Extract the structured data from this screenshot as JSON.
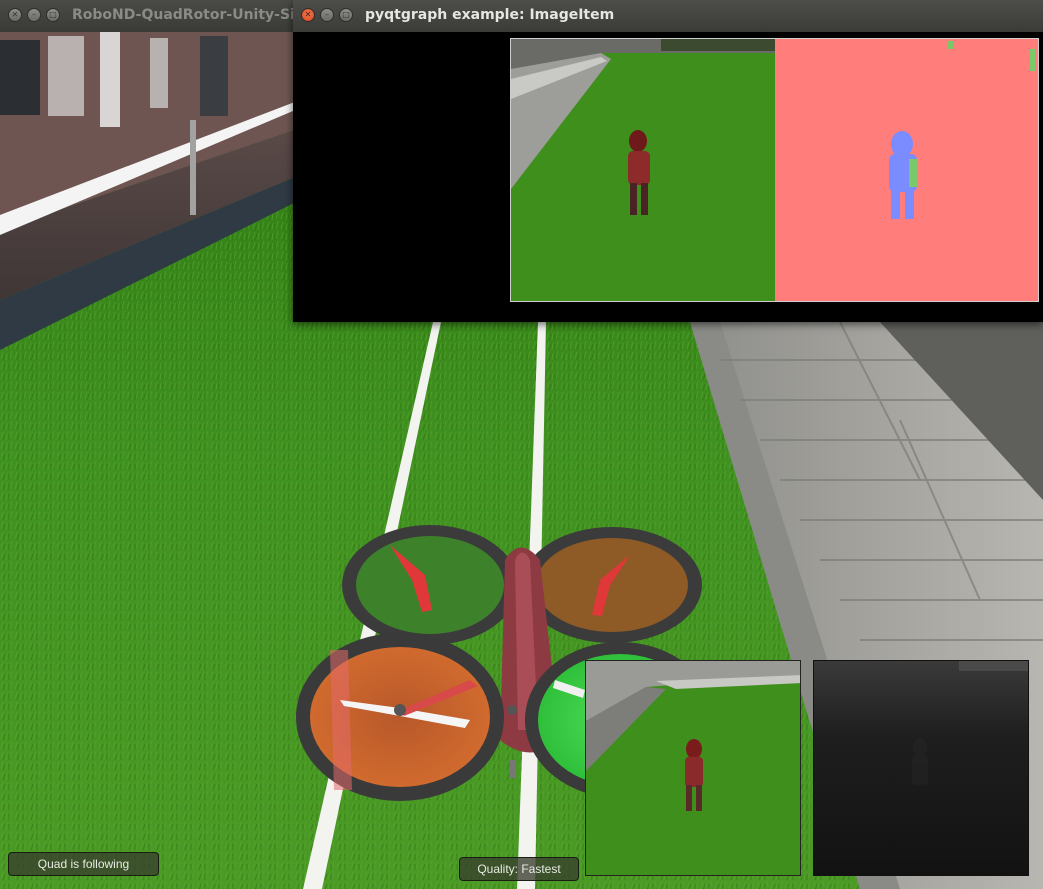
{
  "sim_window": {
    "title": "RoboND-QuadRotor-Unity-Simu",
    "buttons": [
      "close",
      "minimize",
      "maximize"
    ]
  },
  "pg_window": {
    "title": "pyqtgraph example: ImageItem",
    "buttons": [
      "close",
      "minimize",
      "maximize"
    ]
  },
  "status": {
    "follow_label": "Quad is following",
    "quality_label": "Quality: Fastest"
  },
  "icons": {
    "close": "close-icon",
    "minimize": "minimize-icon",
    "maximize": "maximize-icon"
  },
  "colors": {
    "grass": "#3f8f1d",
    "segmentation_background": "#ff7d7b",
    "segmentation_target": "#7a8cff",
    "window_title_active": "#e6e6e2",
    "window_title_inactive": "#8a8a86"
  }
}
